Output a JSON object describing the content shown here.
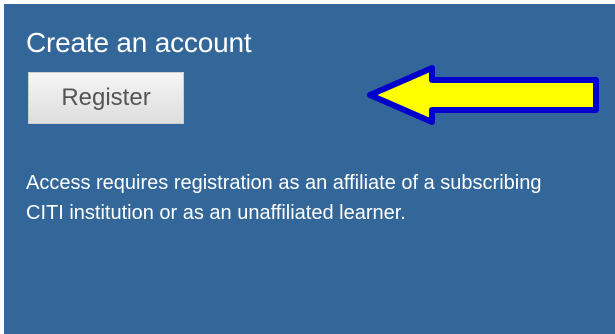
{
  "panel": {
    "title": "Create an account",
    "register_label": "Register",
    "description": "Access requires registration as an affiliate of a subscribing CITI institution or as an unaffiliated learner."
  },
  "annotation": {
    "icon": "arrow-left-icon",
    "fill_color": "#ffff00",
    "stroke_color": "#0000cc"
  },
  "colors": {
    "panel_background": "#336699",
    "text": "#ffffff"
  }
}
